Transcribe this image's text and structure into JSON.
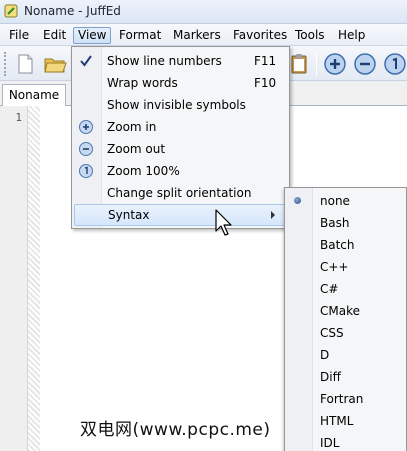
{
  "window": {
    "title": "Noname - JuffEd"
  },
  "menubar": {
    "items": [
      {
        "label": "File"
      },
      {
        "label": "Edit"
      },
      {
        "label": "View"
      },
      {
        "label": "Format"
      },
      {
        "label": "Markers"
      },
      {
        "label": "Favorites"
      },
      {
        "label": "Tools"
      },
      {
        "label": "Help"
      }
    ]
  },
  "tabs": [
    {
      "label": "Noname"
    }
  ],
  "editor": {
    "line_number": "1"
  },
  "view_menu": {
    "items": [
      {
        "label": "Show line numbers",
        "shortcut": "F11",
        "icon": "checkmark-icon",
        "checked": true
      },
      {
        "label": "Wrap words",
        "shortcut": "F10"
      },
      {
        "label": "Show invisible symbols"
      },
      {
        "label": "Zoom in",
        "icon": "zoom-in-icon"
      },
      {
        "label": "Zoom out",
        "icon": "zoom-out-icon"
      },
      {
        "label": "Zoom 100%",
        "icon": "zoom-reset-icon"
      },
      {
        "label": "Change split orientation"
      },
      {
        "label": "Syntax",
        "has_submenu": true
      }
    ]
  },
  "syntax_menu": {
    "selected": "none",
    "items": [
      {
        "label": "none"
      },
      {
        "label": "Bash"
      },
      {
        "label": "Batch"
      },
      {
        "label": "C++"
      },
      {
        "label": "C#"
      },
      {
        "label": "CMake"
      },
      {
        "label": "CSS"
      },
      {
        "label": "D"
      },
      {
        "label": "Diff"
      },
      {
        "label": "Fortran"
      },
      {
        "label": "HTML"
      },
      {
        "label": "IDL"
      }
    ]
  },
  "watermark": {
    "text": "双电网(www.pcpc.me)"
  },
  "colors": {
    "menu_highlight": "#d6e6fb",
    "menu_border": "#7da2ce",
    "radio": "#2d4f8a"
  }
}
